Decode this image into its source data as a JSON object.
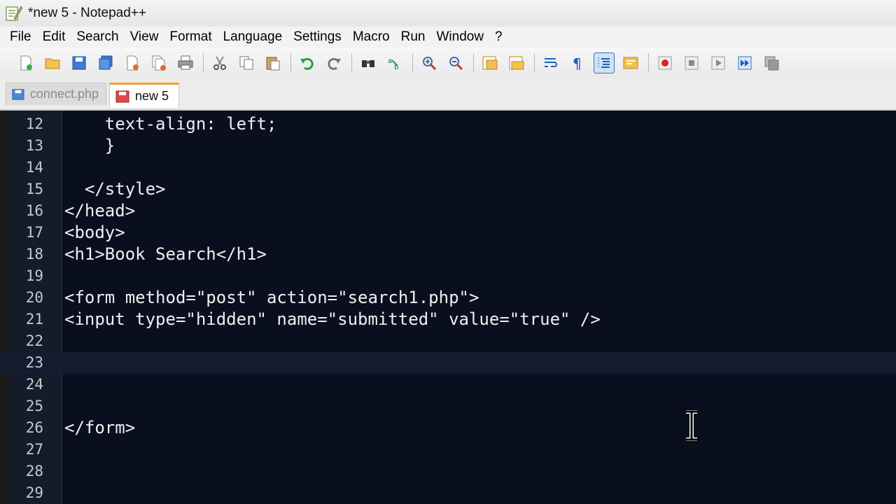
{
  "window": {
    "title": "*new 5 - Notepad++"
  },
  "menu": [
    "File",
    "Edit",
    "Search",
    "View",
    "Format",
    "Language",
    "Settings",
    "Macro",
    "Run",
    "Window",
    "?"
  ],
  "toolbar": {
    "groups": [
      [
        "new-file-icon",
        "open-file-icon",
        "save-icon",
        "save-all-icon",
        "close-icon",
        "close-all-icon",
        "print-icon"
      ],
      [
        "cut-icon",
        "copy-icon",
        "paste-icon"
      ],
      [
        "undo-icon",
        "redo-icon"
      ],
      [
        "find-icon",
        "replace-icon"
      ],
      [
        "zoom-in-icon",
        "zoom-out-icon"
      ],
      [
        "sync-vertical-icon",
        "sync-horizontal-icon"
      ],
      [
        "word-wrap-icon",
        "show-all-chars-icon",
        "indent-guide-icon",
        "user-language-icon"
      ],
      [
        "record-macro-icon",
        "stop-record-icon",
        "play-macro-icon",
        "run-macro-multiple-icon",
        "save-macro-icon"
      ]
    ],
    "active": "indent-guide-icon"
  },
  "tabs": [
    {
      "label": "connect.php",
      "active": false
    },
    {
      "label": "new 5",
      "active": true
    }
  ],
  "editor": {
    "current_line": 23,
    "lines": [
      {
        "n": "12",
        "text": "    text-align: left;"
      },
      {
        "n": "13",
        "text": "    }"
      },
      {
        "n": "14",
        "text": ""
      },
      {
        "n": "15",
        "text": "  </style>"
      },
      {
        "n": "16",
        "text": "</head>"
      },
      {
        "n": "17",
        "text": "<body>"
      },
      {
        "n": "18",
        "text": "<h1>Book Search</h1>"
      },
      {
        "n": "19",
        "text": ""
      },
      {
        "n": "20",
        "text": "<form method=\"post\" action=\"search1.php\">"
      },
      {
        "n": "21",
        "text": "<input type=\"hidden\" name=\"submitted\" value=\"true\" />"
      },
      {
        "n": "22",
        "text": ""
      },
      {
        "n": "23",
        "text": ""
      },
      {
        "n": "24",
        "text": ""
      },
      {
        "n": "25",
        "text": ""
      },
      {
        "n": "26",
        "text": "</form>"
      },
      {
        "n": "27",
        "text": ""
      },
      {
        "n": "28",
        "text": ""
      },
      {
        "n": "29",
        "text": ""
      }
    ]
  },
  "colors": {
    "editor_bg": "#0a0f1f",
    "text": "#f0f0f0",
    "active_tab_accent": "#f5a02a"
  }
}
